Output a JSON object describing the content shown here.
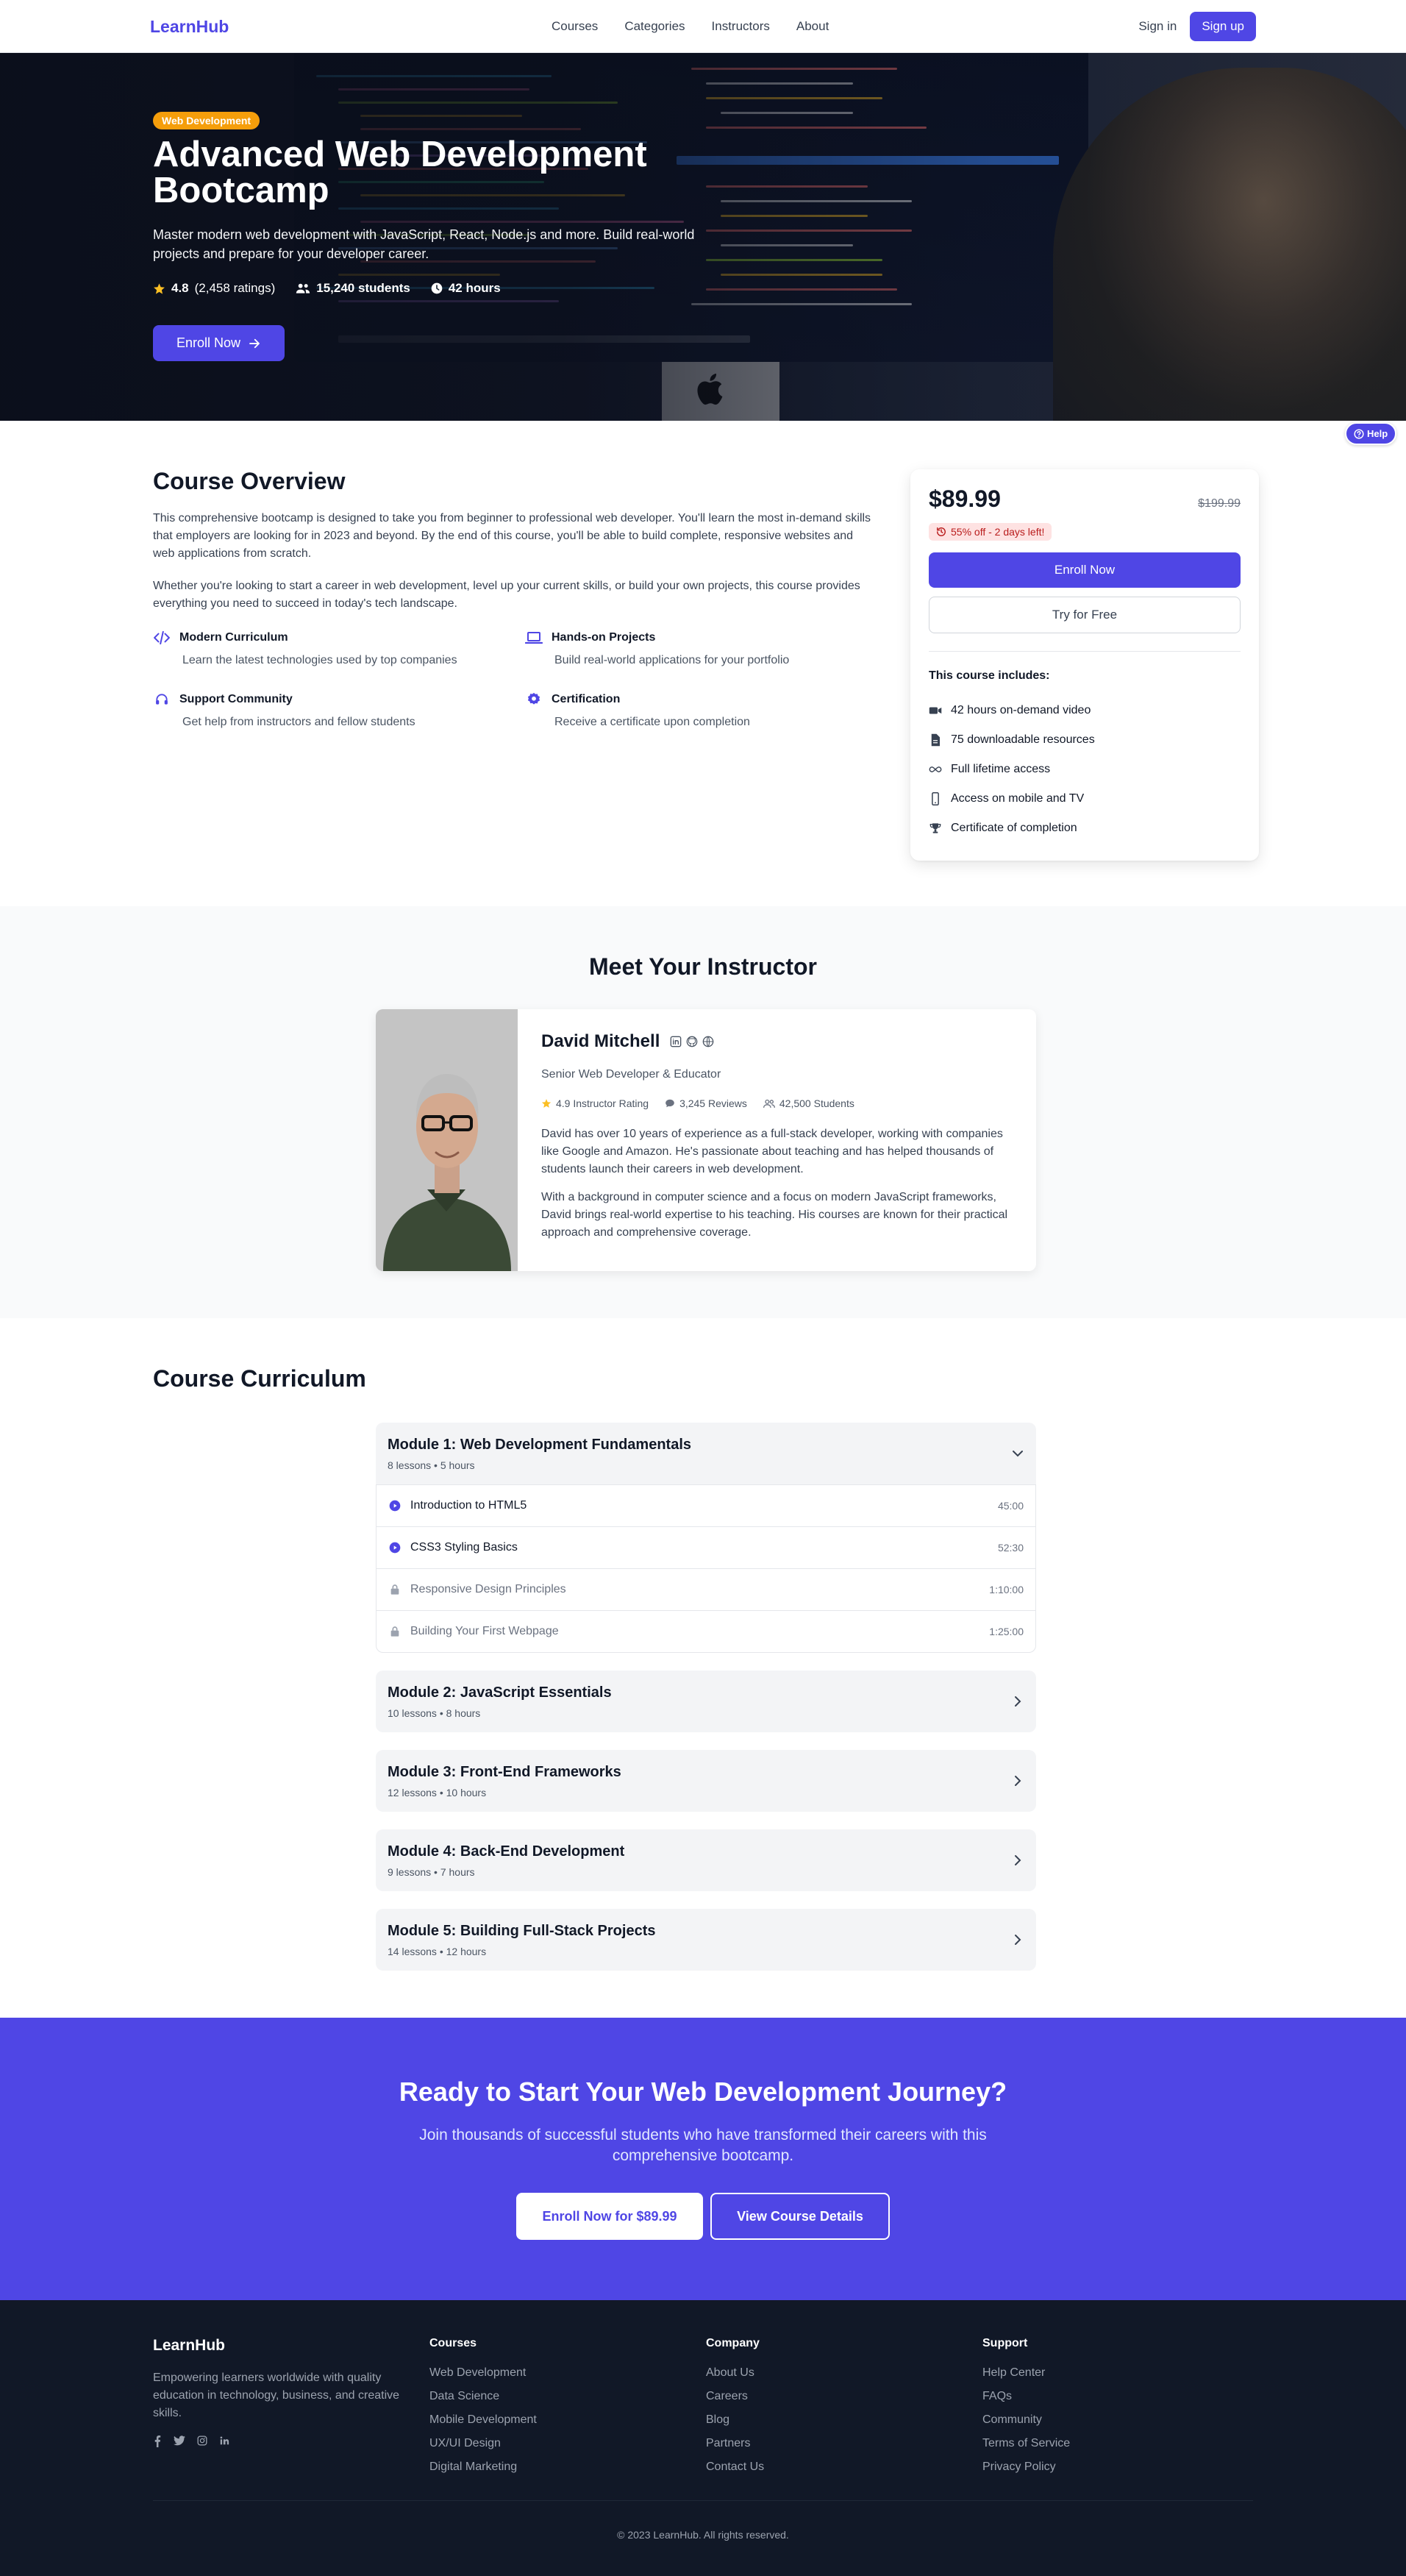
{
  "nav": {
    "logo": "LearnHub",
    "links": [
      "Courses",
      "Categories",
      "Instructors",
      "About"
    ],
    "signin": "Sign in",
    "signup": "Sign up"
  },
  "hero": {
    "badge": "Web Development",
    "title": "Advanced Web Development Bootcamp",
    "subtitle": "Master modern web development with JavaScript, React, Node.js and more. Build real-world projects and prepare for your developer career.",
    "rating": "4.8",
    "ratings_count": "(2,458 ratings)",
    "students": "15,240 students",
    "hours": "42 hours",
    "enroll": "Enroll Now"
  },
  "help": "Help",
  "overview": {
    "title": "Course Overview",
    "p1": "This comprehensive bootcamp is designed to take you from beginner to professional web developer. You'll learn the most in-demand skills that employers are looking for in 2023 and beyond. By the end of this course, you'll be able to build complete, responsive websites and web applications from scratch.",
    "p2": "Whether you're looking to start a career in web development, level up your current skills, or build your own projects, this course provides everything you need to succeed in today's tech landscape.",
    "features": [
      {
        "title": "Modern Curriculum",
        "desc": "Learn the latest technologies used by top companies",
        "icon": "code-icon"
      },
      {
        "title": "Hands-on Projects",
        "desc": "Build real-world applications for your portfolio",
        "icon": "laptop-icon"
      },
      {
        "title": "Support Community",
        "desc": "Get help from instructors and fellow students",
        "icon": "headset-icon"
      },
      {
        "title": "Certification",
        "desc": "Receive a certificate upon completion",
        "icon": "certificate-icon"
      }
    ]
  },
  "pricing": {
    "price": "$89.99",
    "old_price": "$199.99",
    "discount": "55% off - 2 days left!",
    "enroll": "Enroll Now",
    "try": "Try for Free",
    "includes_title": "This course includes:",
    "includes": [
      {
        "text": "42 hours on-demand video",
        "icon": "video-icon"
      },
      {
        "text": "75 downloadable resources",
        "icon": "file-icon"
      },
      {
        "text": "Full lifetime access",
        "icon": "infinity-icon"
      },
      {
        "text": "Access on mobile and TV",
        "icon": "mobile-icon"
      },
      {
        "text": "Certificate of completion",
        "icon": "trophy-icon"
      }
    ]
  },
  "instructor": {
    "section_title": "Meet Your Instructor",
    "name": "David Mitchell",
    "role": "Senior Web Developer & Educator",
    "rating": "4.9 Instructor Rating",
    "reviews": "3,245 Reviews",
    "students": "42,500 Students",
    "bio1": "David has over 10 years of experience as a full-stack developer, working with companies like Google and Amazon. He's passionate about teaching and has helped thousands of students launch their careers in web development.",
    "bio2": "With a background in computer science and a focus on modern JavaScript frameworks, David brings real-world expertise to his teaching. His courses are known for their practical approach and comprehensive coverage."
  },
  "curriculum": {
    "title": "Course Curriculum",
    "modules": [
      {
        "title": "Module 1: Web Development Fundamentals",
        "meta": "8 lessons • 5 hours",
        "lessons": [
          {
            "name": "Introduction to HTML5",
            "duration": "45:00",
            "locked": false
          },
          {
            "name": "CSS3 Styling Basics",
            "duration": "52:30",
            "locked": false
          },
          {
            "name": "Responsive Design Principles",
            "duration": "1:10:00",
            "locked": true
          },
          {
            "name": "Building Your First Webpage",
            "duration": "1:25:00",
            "locked": true
          }
        ]
      },
      {
        "title": "Module 2: JavaScript Essentials",
        "meta": "10 lessons • 8 hours"
      },
      {
        "title": "Module 3: Front-End Frameworks",
        "meta": "12 lessons • 10 hours"
      },
      {
        "title": "Module 4: Back-End Development",
        "meta": "9 lessons • 7 hours"
      },
      {
        "title": "Module 5: Building Full-Stack Projects",
        "meta": "14 lessons • 12 hours"
      }
    ]
  },
  "cta": {
    "title": "Ready to Start Your Web Development Journey?",
    "subtitle": "Join thousands of successful students who have transformed their careers with this comprehensive bootcamp.",
    "primary": "Enroll Now for $89.99",
    "secondary": "View Course Details"
  },
  "footer": {
    "brand": "LearnHub",
    "desc": "Empowering learners worldwide with quality education in technology, business, and creative skills.",
    "columns": [
      {
        "title": "Courses",
        "items": [
          "Web Development",
          "Data Science",
          "Mobile Development",
          "UX/UI Design",
          "Digital Marketing"
        ]
      },
      {
        "title": "Company",
        "items": [
          "About Us",
          "Careers",
          "Blog",
          "Partners",
          "Contact Us"
        ]
      },
      {
        "title": "Support",
        "items": [
          "Help Center",
          "FAQs",
          "Community",
          "Terms of Service",
          "Privacy Policy"
        ]
      }
    ],
    "copyright": "© 2023 LearnHub. All rights reserved."
  }
}
